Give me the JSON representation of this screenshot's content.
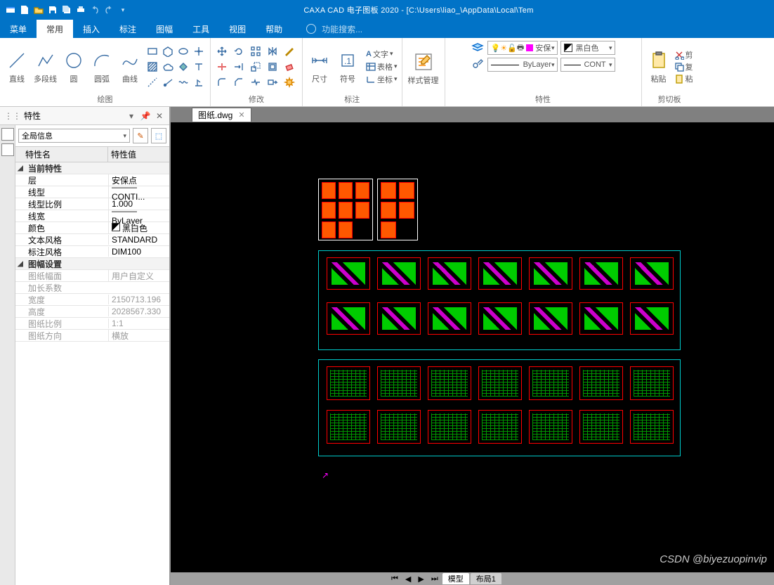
{
  "titlebar": {
    "app_title": "CAXA CAD 电子图板 2020 - [C:\\Users\\liao_\\AppData\\Local\\Tem"
  },
  "menu": {
    "items": [
      "菜单",
      "常用",
      "插入",
      "标注",
      "图幅",
      "工具",
      "视图",
      "帮助"
    ],
    "active_index": 1,
    "search_placeholder": "功能搜索..."
  },
  "ribbon": {
    "groups": {
      "draw": {
        "label": "绘图",
        "buttons": [
          "直线",
          "多段线",
          "圆",
          "圆弧",
          "曲线"
        ]
      },
      "modify": {
        "label": "修改"
      },
      "annotate": {
        "label": "标注",
        "buttons": {
          "dim": "尺寸",
          "symbol": "符号",
          "text": "文字",
          "table": "表格",
          "coord": "坐标"
        }
      },
      "style": {
        "label": "样式管理"
      },
      "props": {
        "label": "特性",
        "layer_combo": "安保",
        "linetype_combo": "ByLayer",
        "color_label": "黑白色",
        "lt2_combo": "CONT"
      },
      "clip": {
        "label": "剪切板",
        "paste": "粘贴",
        "cut": "剪",
        "copy": "复",
        "paste2": "粘"
      }
    }
  },
  "properties_panel": {
    "title": "特性",
    "selector": "全局信息",
    "header_name": "特性名",
    "header_value": "特性值",
    "sections": [
      {
        "title": "当前特性",
        "rows": [
          {
            "n": "层",
            "v": "安保点"
          },
          {
            "n": "线型",
            "v": "——— CONTI..."
          },
          {
            "n": "线型比例",
            "v": "1.000"
          },
          {
            "n": "线宽",
            "v": "——— ByLayer"
          },
          {
            "n": "颜色",
            "v": "黑白色",
            "swatch": true
          },
          {
            "n": "文本风格",
            "v": "STANDARD"
          },
          {
            "n": "标注风格",
            "v": "DIM100"
          }
        ]
      },
      {
        "title": "图幅设置",
        "rows": [
          {
            "n": "图纸幅面",
            "v": "用户自定义",
            "d": true
          },
          {
            "n": "加长系数",
            "v": "",
            "d": true
          },
          {
            "n": "宽度",
            "v": "2150713.196",
            "d": true
          },
          {
            "n": "高度",
            "v": "2028567.330",
            "d": true
          },
          {
            "n": "图纸比例",
            "v": "1:1",
            "d": true
          },
          {
            "n": "图纸方向",
            "v": "横放",
            "d": true
          }
        ]
      }
    ]
  },
  "doc_tab": {
    "name": "图纸.dwg"
  },
  "bottom_tabs": {
    "model": "模型",
    "layout": "布局1"
  },
  "watermark": "CSDN @biyezuopinvip"
}
